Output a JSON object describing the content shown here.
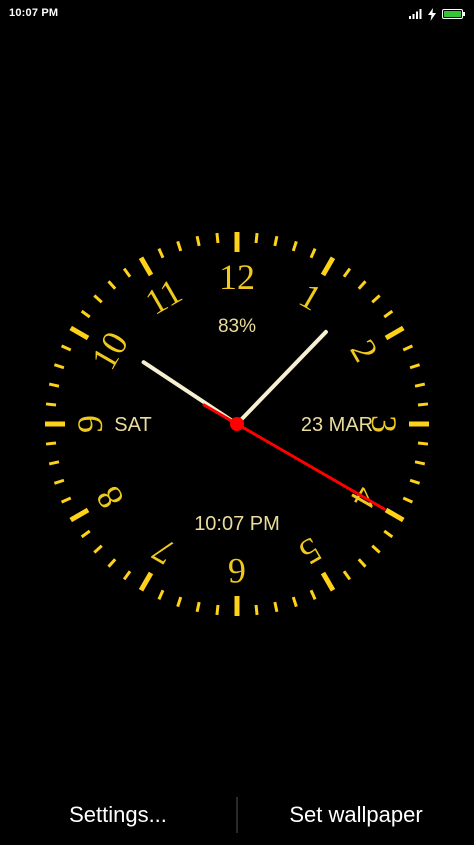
{
  "status_bar": {
    "time": "10:07 PM",
    "icons": [
      "signal-icon",
      "charging-icon",
      "battery-icon"
    ],
    "battery_color": "#35c435"
  },
  "clock": {
    "numerals": [
      "12",
      "1",
      "2",
      "3",
      "4",
      "5",
      "6",
      "7",
      "8",
      "9",
      "10",
      "11"
    ],
    "day_text": "SAT",
    "date_text": "23 MAR",
    "battery_text": "83%",
    "time_text": "10:07 PM",
    "time": {
      "hour": 10,
      "minute": 7,
      "second": 20
    },
    "colors": {
      "ticks": "#ffd21a",
      "numerals": "#f0c91e",
      "info_text": "#eadc9a",
      "hands": "#f5f0d0",
      "second_hand": "#ff0000",
      "face": "#000000"
    }
  },
  "bottom_bar": {
    "settings_label": "Settings...",
    "wallpaper_label": "Set wallpaper"
  }
}
